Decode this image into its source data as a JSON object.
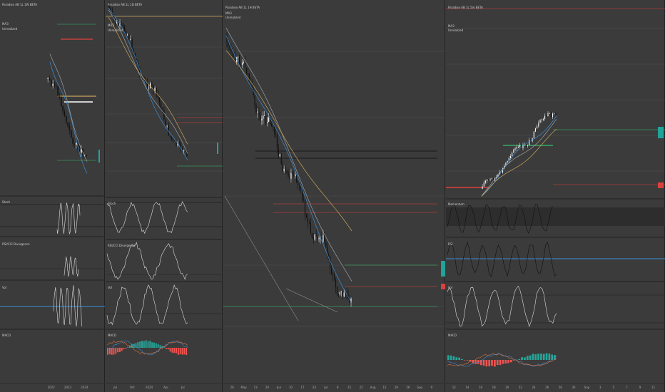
{
  "layout_label": "4 Chart Grid",
  "colors": {
    "bg": "#3b3b3b",
    "grid": "#4a4a4a",
    "up": "#ffffff",
    "down": "#111111",
    "ma_fast": "#3b8fd9",
    "ma_mid": "#9aa0a6",
    "ma_slow": "#c9a45c",
    "green_level": "#35c16b",
    "red_level": "#e0413d",
    "teal_tag": "#21a39a",
    "red_tag": "#d9413e",
    "macd_pos": "#26a69a",
    "macd_neg": "#ef5350",
    "macd_line": "#3b8fd9",
    "signal_line": "#e0703d"
  },
  "charts": [
    {
      "id": "chart-1",
      "title": "Paradise AB 1L 1W BETA",
      "sub1": "MA3",
      "sub2": "Unrealized",
      "indicators": [
        "Stoch",
        "RSI/CCI Divergence",
        "Vol",
        "MACD"
      ],
      "time_labels": [
        "2022",
        "2023",
        "2024"
      ]
    },
    {
      "id": "chart-2",
      "title": "Paradise AB 1L 1D BETA",
      "sub1": "MA3",
      "sub2": "Unrealized",
      "indicators": [
        "Stoch",
        "RSI/CCI Divergence",
        "Vol",
        "MACD"
      ],
      "time_labels": [
        "Jul",
        "Oct",
        "2024",
        "Apr",
        "Jul"
      ]
    },
    {
      "id": "chart-3",
      "title": "Paradise AB 1L 1H BETA",
      "sub1": "MA3",
      "sub2": "Unrealized",
      "indicators": [],
      "time_labels": [
        "26",
        "May",
        "13",
        "20",
        "Jun",
        "10",
        "17",
        "24",
        "Jul",
        "8",
        "15",
        "22",
        "Aug",
        "12",
        "19",
        "26",
        "Sep",
        "9"
      ]
    },
    {
      "id": "chart-4",
      "title": "Paradise AB 1L 5m BETA",
      "sub1": "MA3",
      "sub2": "Unrealized",
      "indicators": [
        "Momentum",
        "RSI",
        "Vol",
        "MACD"
      ],
      "time_labels": [
        "12",
        "14",
        "16",
        "18",
        "20",
        "22",
        "24",
        "26",
        "28",
        "30",
        "Sep",
        "3",
        "5",
        "7",
        "9",
        "11"
      ]
    }
  ]
}
